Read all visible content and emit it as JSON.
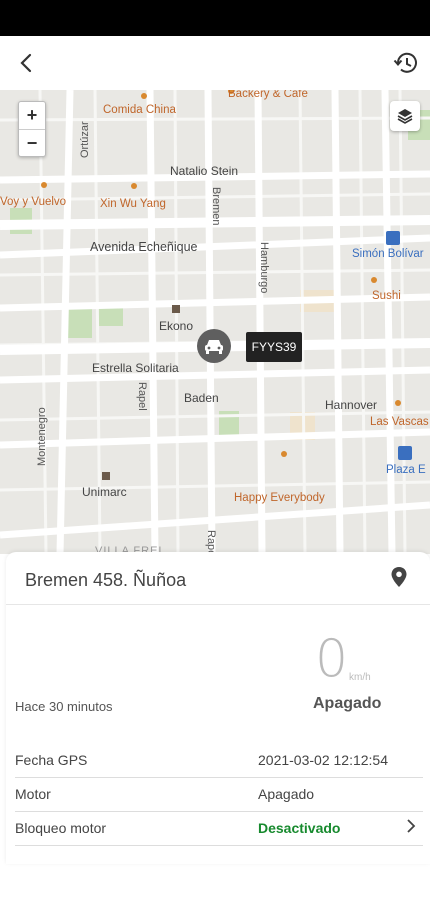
{
  "header": {
    "back_icon": "chevron-left-icon",
    "history_icon": "history-icon"
  },
  "map": {
    "zoom_in": "+",
    "zoom_out": "−",
    "layers_icon": "layers-icon",
    "vehicle_plate": "FYYS39",
    "labels": {
      "comida_china": "Comida China",
      "backery": "Backery & Café",
      "ortuzar": "Ortúzar",
      "natalio_stein": "Natalio Stein",
      "bremen": "Bremen",
      "voy_y_vuelvo": "Voy y Vuelvo",
      "xin_wu_yang": "Xin Wu Yang",
      "avenida_echenique": "Avenida Echeñique",
      "hamburgo": "Hamburgo",
      "simon_bolivar": "Simón Bolívar",
      "sushi": "Sushi",
      "ekono": "Ekono",
      "estrella": "Estrella Solitaria",
      "rapel": "Rapel",
      "baden": "Baden",
      "hannover": "Hannover",
      "las_vascas": "Las Vascas",
      "montenegro": "Montenegro",
      "plaza": "Plaza E",
      "unimarc": "Unimarc",
      "happy": "Happy Everybody",
      "villa": "VILLA FREI",
      "rapel2": "Rapel"
    }
  },
  "card": {
    "address": "Bremen 458. Ñuñoa",
    "speed": "0",
    "speed_unit": "km/h",
    "engine_state": "Apagado",
    "time_ago": "Hace 30 minutos",
    "rows": [
      {
        "label": "Fecha GPS",
        "value": "2021-03-02 12:12:54"
      },
      {
        "label": "Motor",
        "value": "Apagado"
      },
      {
        "label": "Bloqueo motor",
        "value": "Desactivado"
      }
    ],
    "status_color_green": "#178a2e"
  }
}
